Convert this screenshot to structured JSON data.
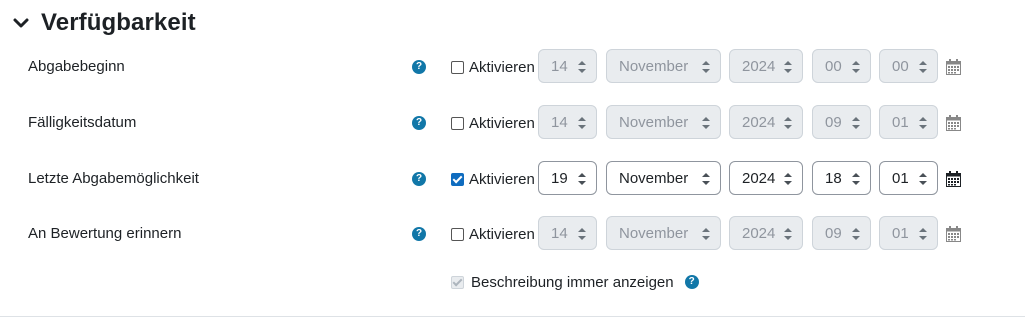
{
  "section": {
    "title": "Verfügbarkeit",
    "icon": "chevron-down-icon"
  },
  "rows": [
    {
      "label": "Abgabebeginn",
      "enable_label": "Aktivieren",
      "enabled": false,
      "day": "14",
      "month": "November",
      "year": "2024",
      "hour": "00",
      "minute": "00"
    },
    {
      "label": "Fälligkeitsdatum",
      "enable_label": "Aktivieren",
      "enabled": false,
      "day": "14",
      "month": "November",
      "year": "2024",
      "hour": "09",
      "minute": "01"
    },
    {
      "label": "Letzte Abgabemöglichkeit",
      "enable_label": "Aktivieren",
      "enabled": true,
      "day": "19",
      "month": "November",
      "year": "2024",
      "hour": "18",
      "minute": "01"
    },
    {
      "label": "An Bewertung erinnern",
      "enable_label": "Aktivieren",
      "enabled": false,
      "day": "14",
      "month": "November",
      "year": "2024",
      "hour": "09",
      "minute": "01"
    }
  ],
  "description": {
    "label": "Beschreibung immer anzeigen",
    "checked": true,
    "disabled": true
  },
  "help_glyph": "?",
  "colors": {
    "accent": "#0f6cbf",
    "help": "#1177a8",
    "disabled_bg": "#e9ecef"
  }
}
